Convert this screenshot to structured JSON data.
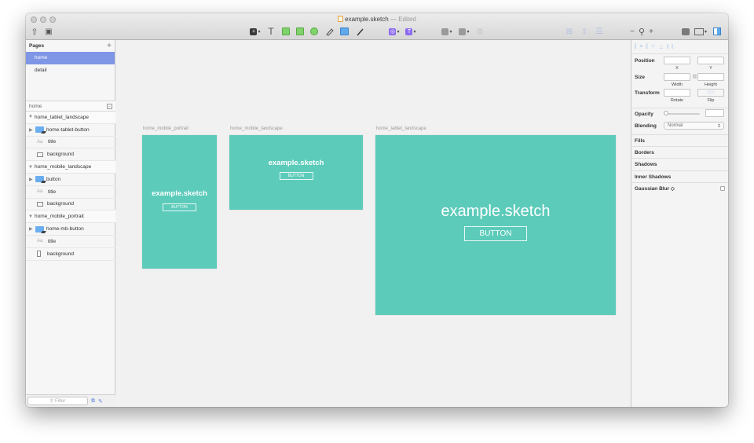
{
  "window": {
    "title": "example.sketch",
    "title_separator": "—",
    "status": "Edited"
  },
  "toolbar": {
    "left_tools": [
      {
        "name": "share-icon",
        "glyph": "⇧"
      },
      {
        "name": "view-icon",
        "glyph": "▣"
      }
    ],
    "zoom_minus": "−",
    "zoom_plus": "+",
    "text_tool_glyph": "T",
    "insert_glyph": "+",
    "tile_glyph": "T"
  },
  "sidebar": {
    "pages_label": "Pages",
    "add_glyph": "+",
    "pages": [
      {
        "label": "home",
        "selected": true
      },
      {
        "label": "detail",
        "selected": false
      }
    ],
    "layers_page": "home",
    "layers": [
      {
        "type": "artboard",
        "label": "home_tablet_landscape"
      },
      {
        "type": "group",
        "label": "home-tablet-button"
      },
      {
        "type": "text",
        "label": "title",
        "icon_text": "Aa"
      },
      {
        "type": "rect",
        "label": "background"
      },
      {
        "type": "artboard",
        "label": "home_mobile_landscape"
      },
      {
        "type": "group",
        "label": "button"
      },
      {
        "type": "text",
        "label": "title",
        "icon_text": "Aa"
      },
      {
        "type": "rect",
        "label": "background"
      },
      {
        "type": "artboard",
        "label": "home_mobile_portrait"
      },
      {
        "type": "group",
        "label": "home-mb-button"
      },
      {
        "type": "text",
        "label": "title",
        "icon_text": "Aa"
      },
      {
        "type": "rect-tall",
        "label": "background"
      }
    ],
    "filter_placeholder": "Filter"
  },
  "canvas": {
    "artboards": [
      {
        "name": "home_mobile_portrait",
        "title": "example.sketch",
        "button": "BUTTON"
      },
      {
        "name": "home_mobile_landscape",
        "title": "example.sketch",
        "button": "BUTTON"
      },
      {
        "name": "home_tablet_landscape",
        "title": "example.sketch",
        "button": "BUTTON"
      }
    ],
    "accent_color": "#5ccbba"
  },
  "inspector": {
    "position_label": "Position",
    "x_label": "X",
    "y_label": "Y",
    "size_label": "Size",
    "width_label": "Width",
    "height_label": "Height",
    "transform_label": "Transform",
    "rotate_label": "Rotate",
    "flip_label": "Flip",
    "opacity_label": "Opacity",
    "blending_label": "Blending",
    "blending_value": "Normal",
    "fills_label": "Fills",
    "borders_label": "Borders",
    "shadows_label": "Shadows",
    "inner_shadows_label": "Inner Shadows",
    "blur_label": "Gaussian Blur ◇"
  }
}
